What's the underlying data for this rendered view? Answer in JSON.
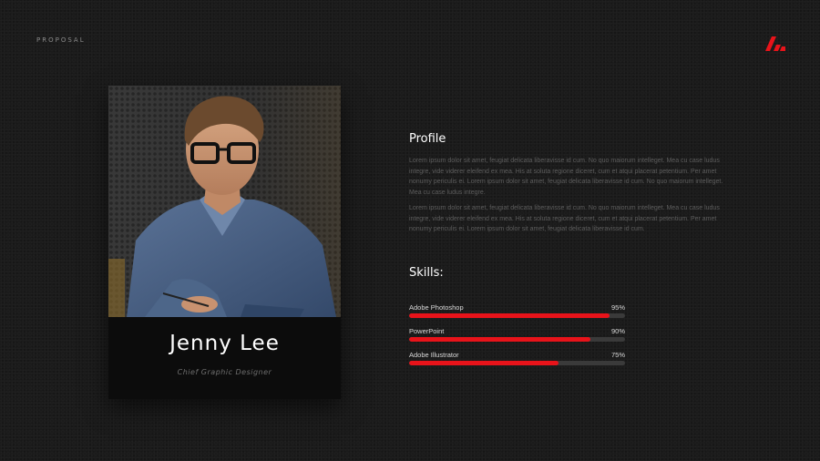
{
  "header": {
    "label": "PROPOSAL",
    "logo_icon": "red-slash-logo-icon",
    "accent": "#e8131a"
  },
  "card": {
    "photo_icon": "person-photo",
    "name": "Jenny Lee",
    "role": "Chief Graphic Designer"
  },
  "profile": {
    "title": "Profile",
    "paragraphs": [
      "Lorem ipsum dolor sit amet, feugiat delicata liberavisse id cum. No quo maiorum intelleget. Mea cu case ludus integre, vide viderer eleifend ex mea. His at soluta regione diceret, cum et atqui placerat petentium. Per amet nonumy periculis ei. Lorem ipsum dolor sit amet, feugiat delicata liberavisse id cum. No quo maiorum intelleget. Mea cu case ludus integre.",
      "Lorem ipsum dolor sit amet, feugiat delicata liberavisse id cum. No quo maiorum intelleget. Mea cu case ludus integre, vide viderer eleifend ex mea. His at soluta regione diceret, cum et atqui placerat petentium. Per amet nonumy periculis ei. Lorem ipsum dolor sit amet, feugiat delicata liberavisse id cum."
    ]
  },
  "skills": {
    "title": "Skills:",
    "track_color": "#3a3a3a",
    "fill_color": "#e8131a",
    "items": [
      {
        "name": "Adobe Photoshop",
        "percent_label": "95%",
        "level": 0.93
      },
      {
        "name": "PowerPoint",
        "percent_label": "90%",
        "level": 0.84
      },
      {
        "name": "Adobe Illustrator",
        "percent_label": "75%",
        "level": 0.69
      }
    ]
  }
}
